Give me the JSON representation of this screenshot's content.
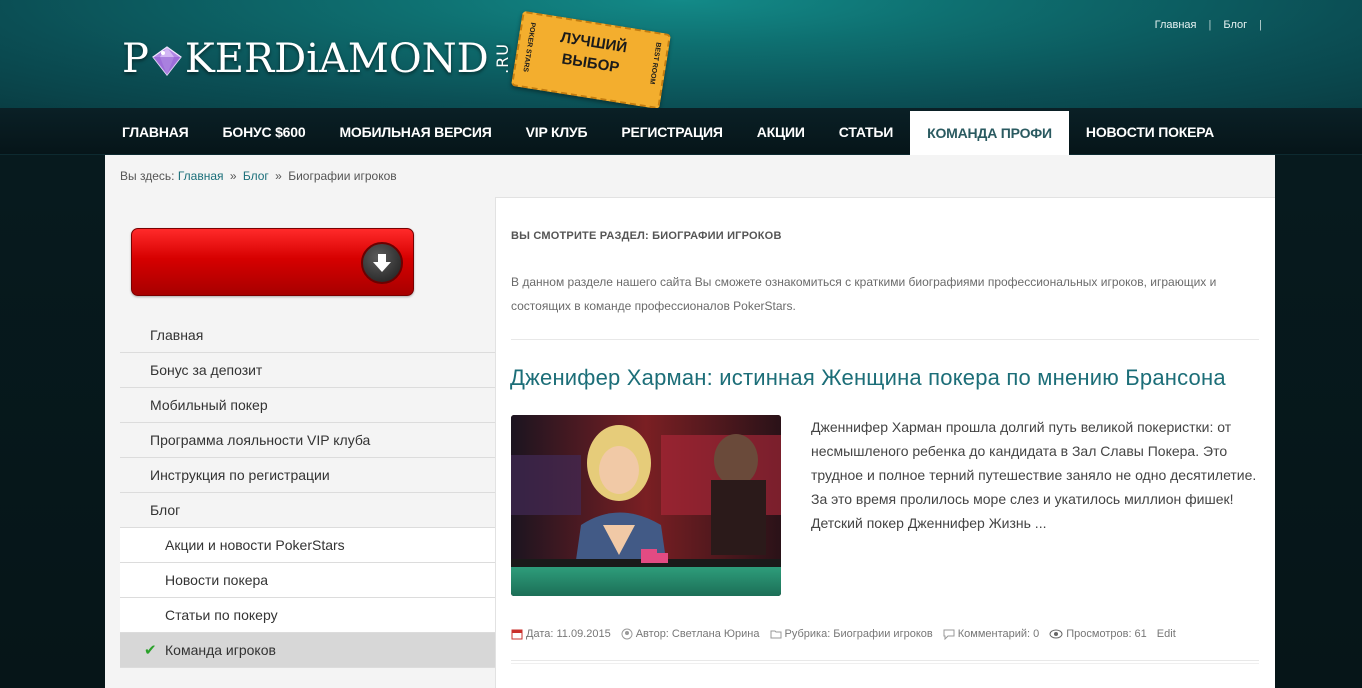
{
  "header": {
    "logo": {
      "part1": "P",
      "part2": "KERDiAMOND",
      "suffix": ".RU"
    },
    "ticket": {
      "line1": "ЛУЧШИЙ",
      "line2": "ВЫБОР",
      "left_side": "POKER STARS",
      "right_side": "BEST ROOM"
    },
    "top_links": [
      {
        "label": "Главная"
      },
      {
        "label": "Блог"
      }
    ]
  },
  "nav": {
    "items": [
      {
        "label": "ГЛАВНАЯ"
      },
      {
        "label": "БОНУС $600"
      },
      {
        "label": "МОБИЛЬНАЯ ВЕРСИЯ"
      },
      {
        "label": "VIP КЛУБ"
      },
      {
        "label": "РЕГИСТРАЦИЯ"
      },
      {
        "label": "АКЦИИ"
      },
      {
        "label": "СТАТЬИ"
      },
      {
        "label": "КОМАНДА ПРОФИ",
        "active": true
      },
      {
        "label": "НОВОСТИ ПОКЕРА"
      }
    ]
  },
  "breadcrumb": {
    "prefix": "Вы здесь:",
    "links": [
      "Главная",
      "Блог"
    ],
    "separator": "»",
    "current": "Биографии игроков"
  },
  "sidebar": {
    "menu": [
      {
        "label": "Главная"
      },
      {
        "label": "Бонус за депозит"
      },
      {
        "label": "Мобильный покер"
      },
      {
        "label": "Программа лояльности VIP клуба"
      },
      {
        "label": "Инструкция по регистрации"
      },
      {
        "label": "Блог"
      },
      {
        "label": "Акции и новости PokerStars",
        "sub": true
      },
      {
        "label": "Новости покера",
        "sub": true
      },
      {
        "label": "Статьи по покеру",
        "sub": true
      },
      {
        "label": "Команда игроков",
        "sub": true,
        "current": true
      }
    ]
  },
  "main": {
    "section_title": "ВЫ СМОТРИТЕ РАЗДЕЛ: БИОГРАФИИ ИГРОКОВ",
    "section_desc": "В данном разделе нашего сайта Вы сможете ознакомиться с краткими биографиями профессиональных игроков, играющих и состоящих в команде профессионалов PokerStars.",
    "post": {
      "title": "Дженифер Харман: истинная Женщина покера по мнению Брансона",
      "excerpt": "Дженнифер Харман прошла долгий путь великой покеристки: от несмышленого ребенка до кандидата в Зал Славы Покера. Это трудное и полное терний путешествие заняло не одно десятилетие. За это время пролилось море слез и укатилось миллион фишек! Детский покер Дженнифер Жизнь ...",
      "meta": {
        "date": "Дата: 11.09.2015",
        "author": "Автор: Светлана Юрина",
        "category": "Рубрика: Биографии игроков",
        "comments": "Комментарий: 0",
        "views": "Просмотров: 61",
        "edit": "Edit"
      }
    }
  },
  "colors": {
    "accent": "#1c6e78",
    "cta_red": "#d60000",
    "header_teal": "#0e6f70"
  }
}
